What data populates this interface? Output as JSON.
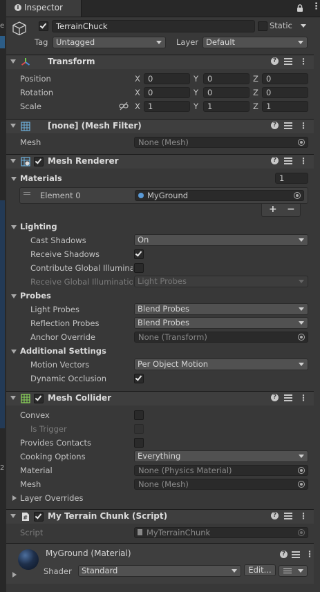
{
  "tab": {
    "title": "Inspector"
  },
  "gameobject": {
    "name": "TerrainChuck",
    "static_label": "Static",
    "tag_label": "Tag",
    "tag_value": "Untagged",
    "layer_label": "Layer",
    "layer_value": "Default",
    "active": true,
    "static": false
  },
  "transform": {
    "title": "Transform",
    "position_label": "Position",
    "rotation_label": "Rotation",
    "scale_label": "Scale",
    "axis_x": "X",
    "axis_y": "Y",
    "axis_z": "Z",
    "position": [
      "0",
      "0",
      "0"
    ],
    "rotation": [
      "0",
      "0",
      "0"
    ],
    "scale": [
      "1",
      "1",
      "1"
    ]
  },
  "mesh_filter": {
    "title": "[none] (Mesh Filter)",
    "mesh_label": "Mesh",
    "mesh_value": "None (Mesh)"
  },
  "mesh_renderer": {
    "title": "Mesh Renderer",
    "enabled": true,
    "materials_label": "Materials",
    "materials_count": "1",
    "element0_label": "Element 0",
    "element0_value": "MyGround",
    "plus": "+",
    "minus": "−",
    "lighting_label": "Lighting",
    "cast_shadows_label": "Cast Shadows",
    "cast_shadows_value": "On",
    "receive_shadows_label": "Receive Shadows",
    "receive_shadows": true,
    "contribute_gi_label": "Contribute Global Illuminati",
    "contribute_gi": false,
    "receive_gi_label": "Receive Global Illuminatior",
    "receive_gi_value": "Light Probes",
    "probes_label": "Probes",
    "light_probes_label": "Light Probes",
    "light_probes_value": "Blend Probes",
    "reflection_probes_label": "Reflection Probes",
    "reflection_probes_value": "Blend Probes",
    "anchor_override_label": "Anchor Override",
    "anchor_override_value": "None (Transform)",
    "additional_label": "Additional Settings",
    "motion_vectors_label": "Motion Vectors",
    "motion_vectors_value": "Per Object Motion",
    "dynamic_occlusion_label": "Dynamic Occlusion",
    "dynamic_occlusion": true
  },
  "mesh_collider": {
    "title": "Mesh Collider",
    "enabled": true,
    "convex_label": "Convex",
    "convex": false,
    "is_trigger_label": "Is Trigger",
    "is_trigger": false,
    "provides_contacts_label": "Provides Contacts",
    "provides_contacts": false,
    "cooking_label": "Cooking Options",
    "cooking_value": "Everything",
    "material_label": "Material",
    "material_value": "None (Physics Material)",
    "mesh_label": "Mesh",
    "mesh_value": "None (Mesh)",
    "layer_overrides_label": "Layer Overrides"
  },
  "script": {
    "title": "My Terrain Chunk (Script)",
    "enabled": true,
    "script_label": "Script",
    "script_value": "MyTerrainChunk"
  },
  "material": {
    "title": "MyGround (Material)",
    "shader_label": "Shader",
    "shader_value": "Standard",
    "edit_label": "Edit..."
  },
  "colors": {
    "background": "#383838",
    "header": "#3e3e3e",
    "field": "#2a2a2a",
    "dropdown": "#515151"
  }
}
